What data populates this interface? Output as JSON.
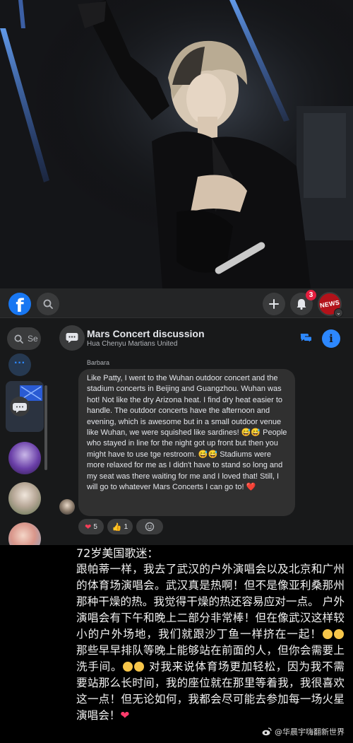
{
  "facebook": {
    "search_placeholder": "Se",
    "notifications_count": "3",
    "account_label": "NEWS"
  },
  "chat": {
    "title": "Mars Concert discussion",
    "subtitle": "Hua Chenyu Martians United",
    "sender": "Barbara",
    "message": "Like Patty, I went to the Wuhan outdoor concert and the stadium concerts in Beijing and Guangzhou. Wuhan was hot! Not like the dry Arizona heat. I find dry heat easier to handle. The outdoor concerts have the afternoon and evening, which is awesome but in a small outdoor venue like Wuhan, we were squished like sardines! 😅😅 People who stayed in line for the night got up front but then you might have to use tge restroom. 😅😅 Stadiums were more relaxed for me as I didn't have to stand so long and my seat was there waiting for me and I loved that! Still, I will go to whatever Mars Concerts I can go to! ❤️",
    "reactions": [
      {
        "icon": "heart",
        "count": "5"
      },
      {
        "icon": "thumbs-up",
        "count": "1"
      },
      {
        "icon": "add-reaction",
        "count": ""
      }
    ]
  },
  "translation": {
    "who": "72岁美国歌迷：",
    "p1": "跟帕蒂一样，我去了武汉的户外演唱会以及北京和广州的体育场演唱会。武汉真是热啊！但不是像亚利桑那州那种干燥的热。我觉得干燥的热还容易应对一点。 户外演唱会有下午和晚上二部分非常棒！但在像武汉这样较小的户外场地，我们就跟沙丁鱼一样挤在一起！",
    "p2": "那些早早排队等晚上能够站在前面的人，但你会需要上洗手间。",
    "p3": "对我来说体育场更加轻松，因为我不需要站那么长时间，我的座位就在那里等着我，我很喜欢这一点！但无论如何，我都会尽可能去参加每一场火星演唱会！",
    "watermark": "@华晨宇嗨翻新世界"
  },
  "colors": {
    "fb_blue": "#1877f2",
    "bubble": "#303030",
    "background": "#18191a",
    "badge": "#e41e3f"
  }
}
